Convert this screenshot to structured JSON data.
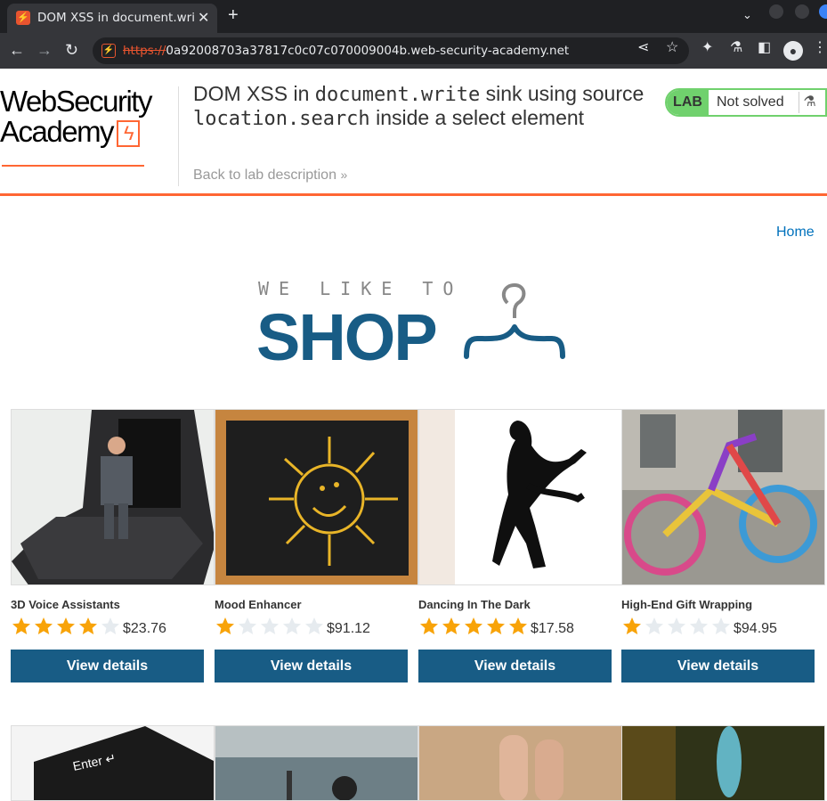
{
  "browser": {
    "tab_title": "DOM XSS in document.write",
    "url_scheme": "https://",
    "url_host": "0a92008703a37817c0c07c070009004b.web-security-academy.net"
  },
  "lab": {
    "logo_line1": "WebSecurity",
    "logo_line2": "Academy",
    "title_parts": [
      "DOM XSS in ",
      "document.write",
      " sink using source ",
      "location.search",
      " inside a select element"
    ],
    "back_link": "Back to lab description",
    "status_badge": "LAB",
    "status_text": "Not solved"
  },
  "shop": {
    "home_link": "Home",
    "logo_top": "WE LIKE TO",
    "logo_main": "SHOP",
    "products": [
      {
        "name": "3D Voice Assistants",
        "rating": 4,
        "price": "$23.76",
        "button": "View details"
      },
      {
        "name": "Mood Enhancer",
        "rating": 1,
        "price": "$91.12",
        "button": "View details"
      },
      {
        "name": "Dancing In The Dark",
        "rating": 5,
        "price": "$17.58",
        "button": "View details"
      },
      {
        "name": "High-End Gift Wrapping",
        "rating": 1,
        "price": "$94.95",
        "button": "View details"
      }
    ]
  },
  "colors": {
    "accent": "#ff6633",
    "button": "#185c85",
    "link": "#0071bc",
    "star_on": "#f8a308",
    "star_off": "#e6ebef",
    "lab_green": "#70d16d"
  }
}
